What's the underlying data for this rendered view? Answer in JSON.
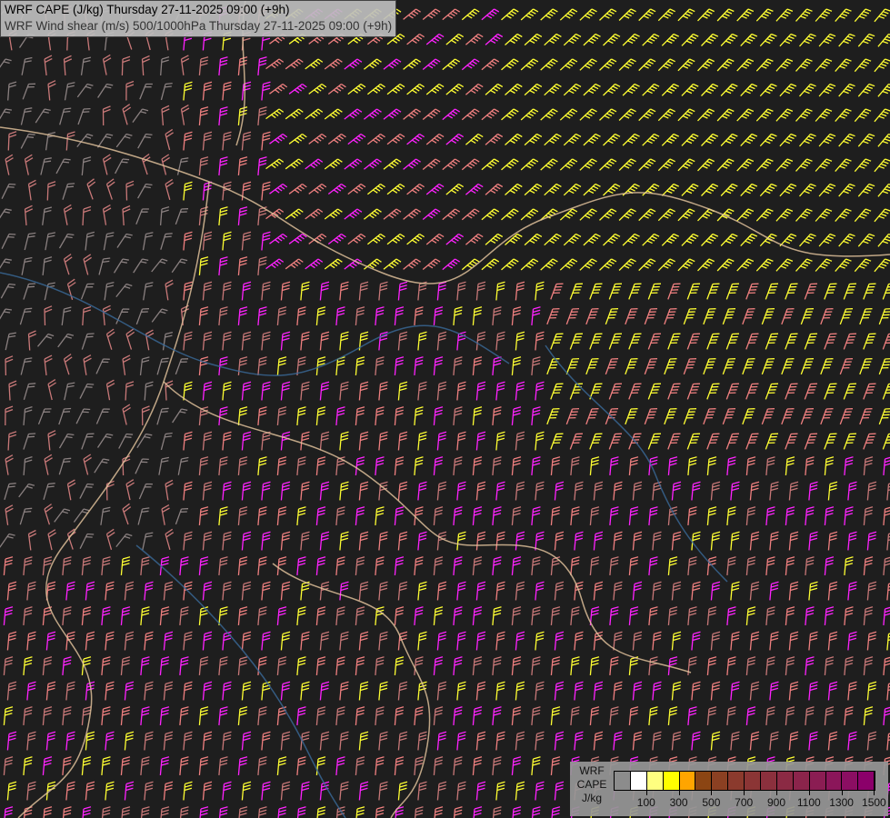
{
  "title": {
    "line1": "WRF CAPE (J/kg) Thursday 27-11-2025 09:00 (+9h)",
    "line2": "WRF Wind shear (m/s) 500/1000hPa Thursday 27-11-2025 09:00 (+9h)"
  },
  "legend": {
    "label_lines": [
      "WRF",
      "CAPE",
      "J/kg"
    ],
    "colors": [
      "#8c8c8c",
      "#ffffff",
      "#ffff80",
      "#ffff00",
      "#ffa500",
      "#8b4513",
      "#8b4022",
      "#8b3a2d",
      "#8b3535",
      "#8b303d",
      "#8b2a44",
      "#8b244b",
      "#8b1d53",
      "#8b165a",
      "#8b0e62",
      "#8b006a"
    ],
    "ticks": [
      "100",
      "300",
      "500",
      "700",
      "900",
      "1100",
      "1300",
      "1500"
    ]
  },
  "barb_colors": {
    "yellow": "#ffff33",
    "magenta": "#ff22ff",
    "salmon": "#f08080",
    "rose": "#c87878",
    "gray": "#8a8080",
    "border": "#e8c8a0",
    "river": "#3a6a9a"
  }
}
